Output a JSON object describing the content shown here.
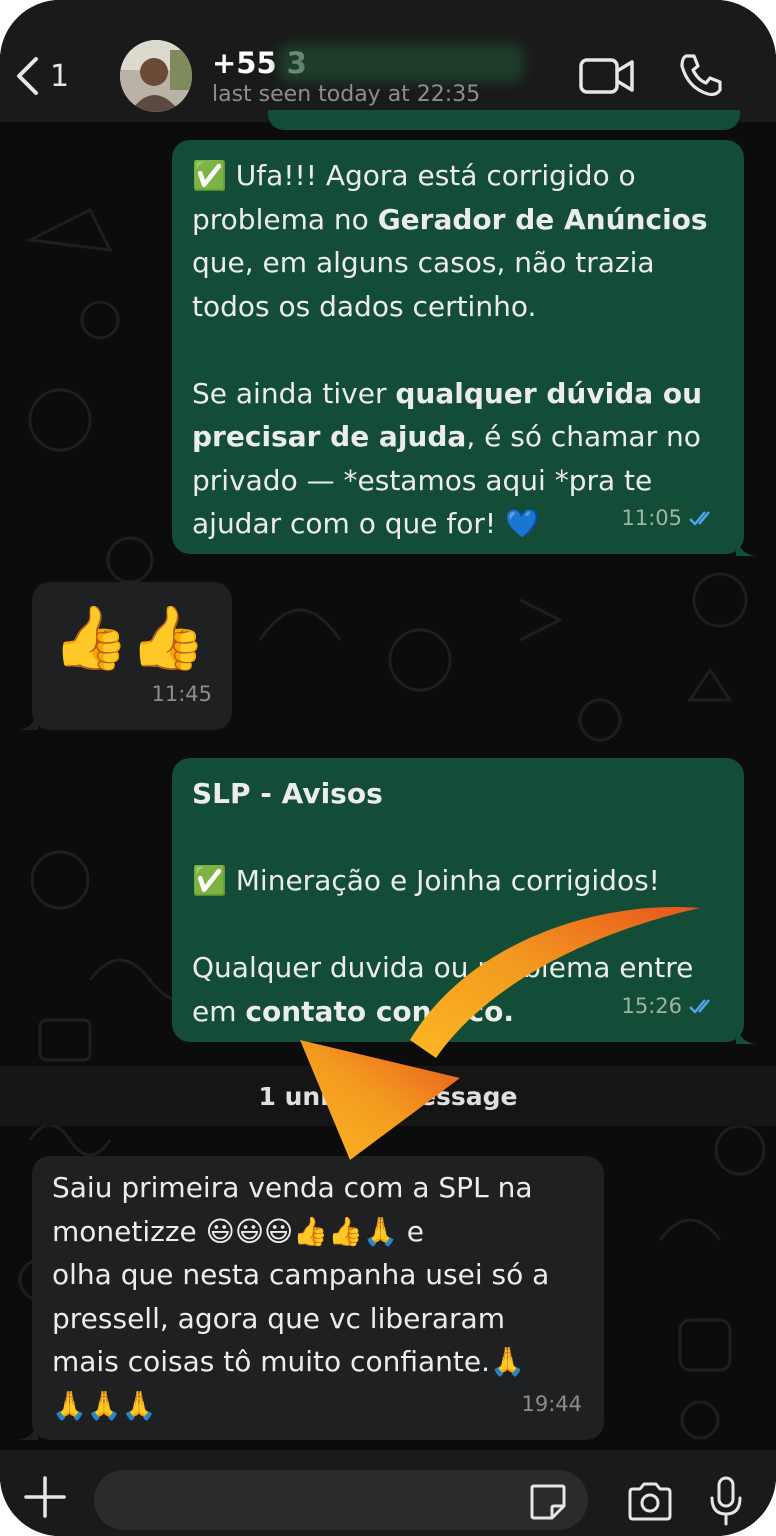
{
  "header": {
    "back_count": "1",
    "contact_name": "+55 3",
    "last_seen": "last seen today at 22:35"
  },
  "messages": [
    {
      "direction": "outgoing",
      "emoji_lead": "✅",
      "text_1": " Ufa!!! Agora está corrigido o\nproblema no ",
      "bold_1": "Gerador de Anúncios",
      "text_2": "\nque, em alguns casos, não trazia\ntodos os dados certinho.\n\nSe ainda tiver ",
      "bold_2": "qualquer dúvida ou\nprecisar de ajuda",
      "text_3": ", é só chamar no\nprivado — *estamos aqui *pra te\najudar com o que for! ",
      "emoji_end": "💙",
      "time": "11:05",
      "status": "read"
    },
    {
      "direction": "incoming",
      "emoji": "👍👍",
      "time": "11:45"
    },
    {
      "direction": "outgoing",
      "bold_title": "SLP - Avisos",
      "emoji_lead": "✅",
      "text_1": " Mineração e Joinha corrigidos!\n\nQualquer duvida ou problema entre\nem ",
      "bold_1": "contato conosco.",
      "time": "15:26",
      "status": "read"
    },
    {
      "direction": "incoming",
      "text": "Saiu primeira venda com a SPL na\nmonetizze 😃😃😃👍👍🙏 e\nolha que nesta campanha usei só a\npressell, agora que vc liberaram\nmais coisas tô muito confiante.🙏\n🙏🙏🙏",
      "time": "19:44"
    }
  ],
  "unread_divider": "1 unread message",
  "composer": {
    "placeholder": ""
  },
  "colors": {
    "outgoing_bubble": "#134d37",
    "incoming_bubble": "#1f2022",
    "read_ticks": "#53a6f5",
    "arrow": "#f5a623"
  },
  "icons": [
    "back-chevron-icon",
    "video-call-icon",
    "phone-call-icon",
    "plus-icon",
    "sticker-icon",
    "camera-icon",
    "microphone-icon",
    "double-check-icon"
  ]
}
